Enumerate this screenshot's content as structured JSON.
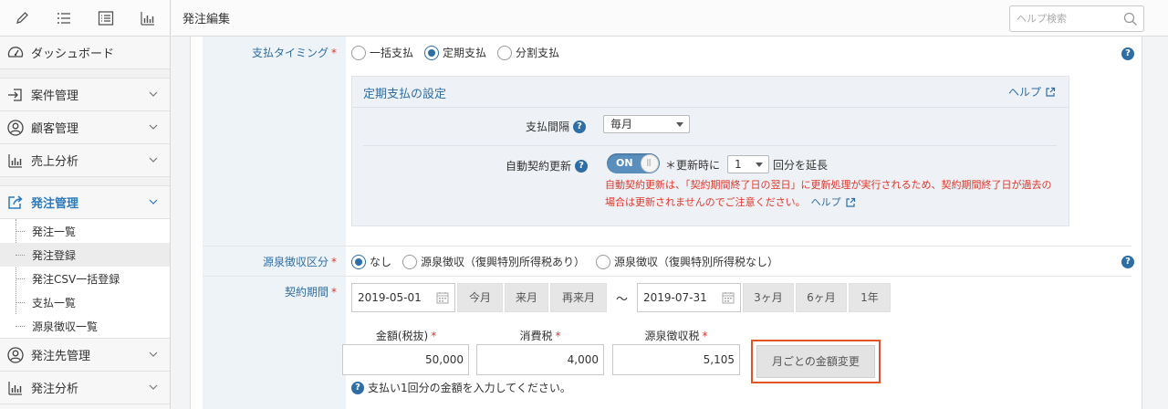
{
  "header": {
    "title": "発注編集",
    "search_placeholder": "ヘルプ検索"
  },
  "sidebar": {
    "toolbar_icons": [
      "pencil-icon",
      "list-icon",
      "list-box-icon",
      "bar-chart-icon"
    ],
    "items": [
      {
        "label": "ダッシュボード",
        "icon": "speedometer-icon"
      },
      {
        "label": "案件管理",
        "icon": "login-icon"
      },
      {
        "label": "顧客管理",
        "icon": "person-circle-icon"
      },
      {
        "label": "売上分析",
        "icon": "bar-chart-icon"
      },
      {
        "label": "発注管理",
        "icon": "share-icon"
      },
      {
        "label": "発注先管理",
        "icon": "person-circle-icon"
      },
      {
        "label": "発注分析",
        "icon": "bar-chart-icon"
      }
    ],
    "sub_items": [
      "発注一覧",
      "発注登録",
      "発注CSV一括登録",
      "支払一覧",
      "源泉徴収一覧"
    ],
    "selected_sub": "発注登録",
    "accent": "#2a7bc0"
  },
  "form": {
    "payment_timing": {
      "label": "支払タイミング",
      "options": [
        "一括支払",
        "定期支払",
        "分割支払"
      ],
      "selected": "定期支払"
    },
    "periodic": {
      "title": "定期支払の設定",
      "help_link": "ヘルプ",
      "interval_label": "支払間隔",
      "interval_value": "毎月",
      "auto_renew_label": "自動契約更新",
      "toggle_label": "ON",
      "renew_prefix": "＊更新時に",
      "renew_count": "1",
      "renew_suffix": "回分を延長",
      "warning": "自動契約更新は、「契約期間終了日の翌日」に更新処理が実行されるため、契約期間終了日が過去の",
      "warning2": "場合は更新されませんのでご注意ください。",
      "warning_link": "ヘルプ"
    },
    "withholding": {
      "label": "源泉徴収区分",
      "options": [
        "なし",
        "源泉徴収（復興特別所得税あり）",
        "源泉徴収（復興特別所得税なし）"
      ],
      "selected": "なし"
    },
    "period": {
      "label": "契約期間",
      "start": "2019-05-01",
      "start_buttons": [
        "今月",
        "来月",
        "再来月"
      ],
      "separator": "〜",
      "end": "2019-07-31",
      "end_buttons": [
        "3ヶ月",
        "6ヶ月",
        "1年"
      ]
    },
    "amounts": {
      "amount_label": "金額(税抜)",
      "amount_value": "50,000",
      "tax_label": "消費税",
      "tax_value": "4,000",
      "withholding_label": "源泉徴収税",
      "withholding_value": "5,105",
      "monthly_button": "月ごとの金額変更",
      "note": "支払い1回分の金額を入力してください。"
    },
    "required_mark": "*",
    "help_mark": "?"
  },
  "colors": {
    "link": "#2f6ea5",
    "required": "#e0382b",
    "highlight_border": "#e2532a"
  }
}
